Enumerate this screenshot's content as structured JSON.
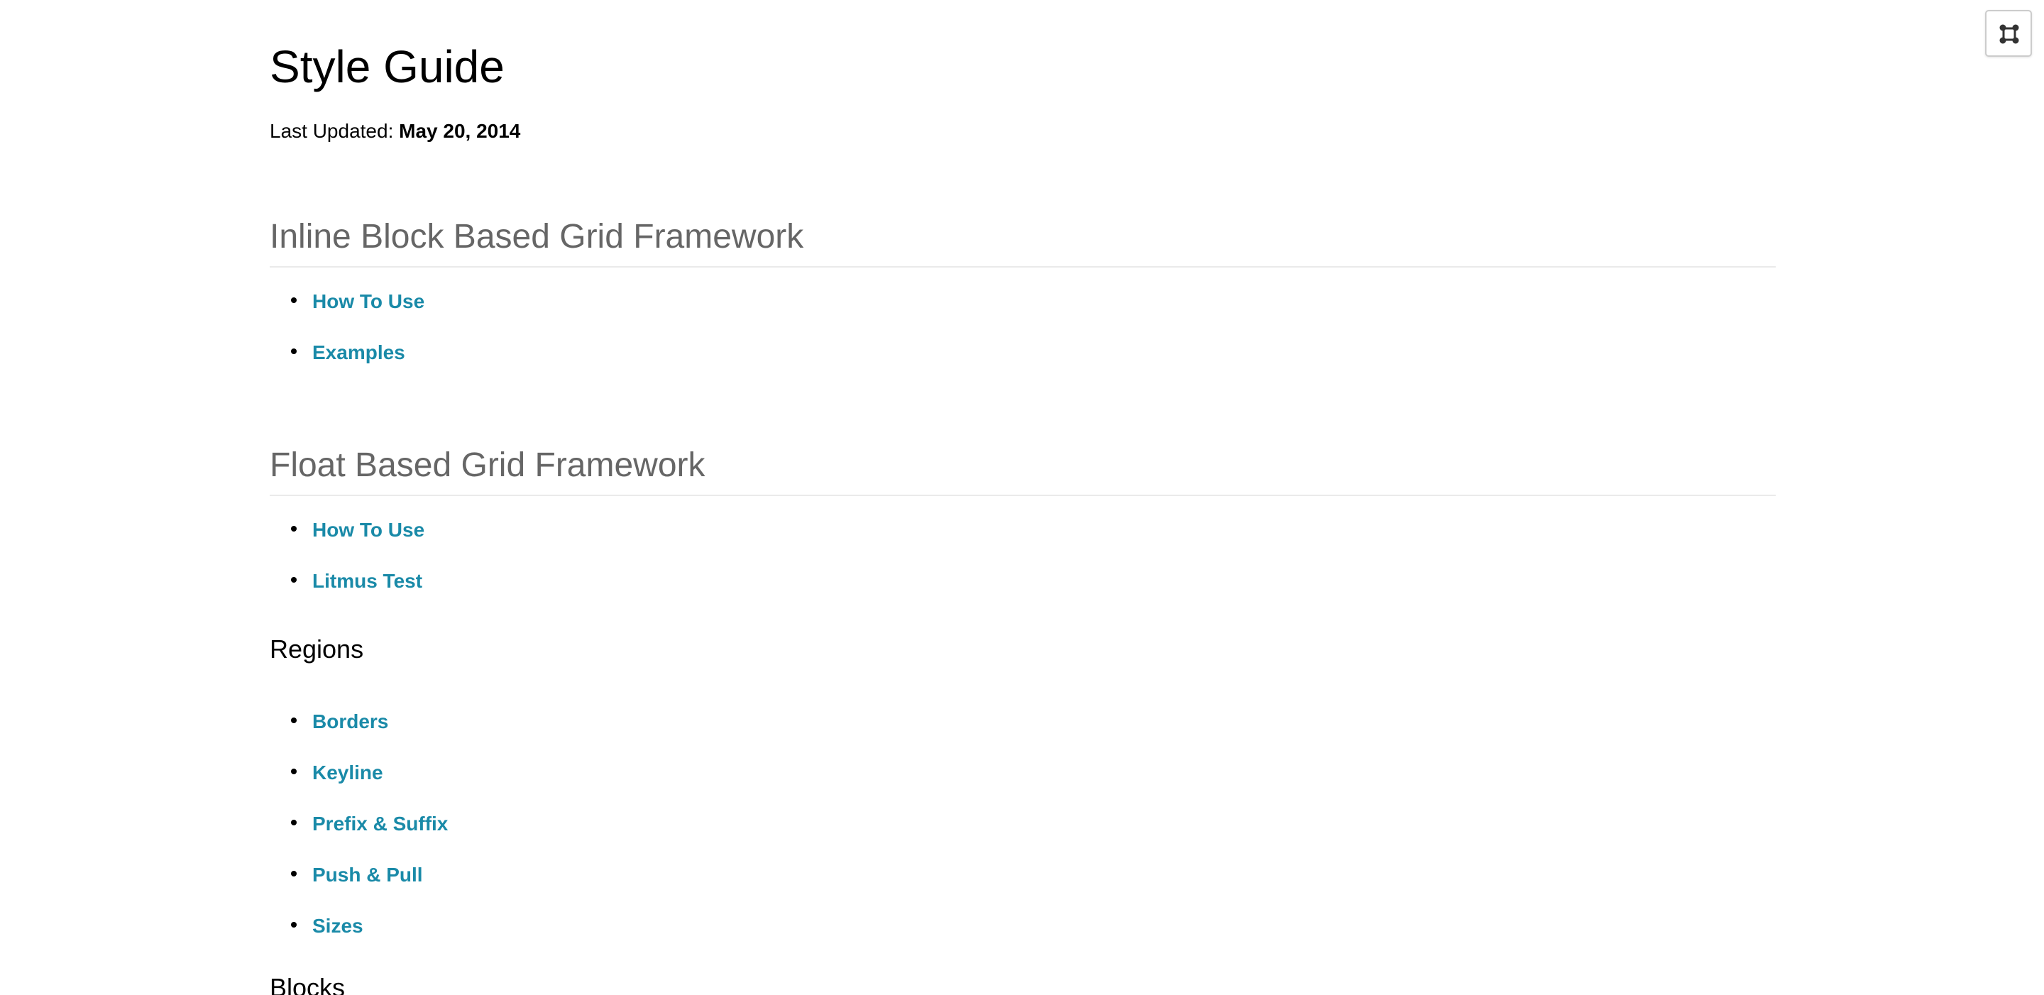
{
  "header": {
    "title": "Style Guide",
    "last_updated_label": "Last Updated:",
    "last_updated_date": "May 20, 2014"
  },
  "sections": [
    {
      "title": "Inline Block Based Grid Framework",
      "links": [
        "How To Use",
        "Examples"
      ]
    },
    {
      "title": "Float Based Grid Framework",
      "links": [
        "How To Use",
        "Litmus Test"
      ],
      "subsections": [
        {
          "title": "Regions",
          "links": [
            "Borders",
            "Keyline",
            "Prefix & Suffix",
            "Push & Pull",
            "Sizes"
          ]
        },
        {
          "title": "Blocks"
        }
      ]
    }
  ],
  "toolbar": {
    "corner_icon": "frame-toggle-icon"
  },
  "colors": {
    "link": "#1a8aa8",
    "section_title": "#666666",
    "rule": "#eaeaea"
  }
}
